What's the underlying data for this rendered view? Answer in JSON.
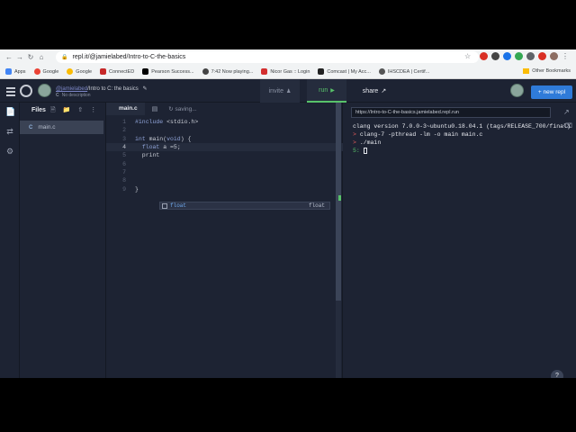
{
  "browser": {
    "url": "repl.it/@jamielabed/Intro-to-C-the-basics",
    "bookmarks": [
      {
        "label": "Apps",
        "color": "#4285f4"
      },
      {
        "label": "Google",
        "color": "#ea4335"
      },
      {
        "label": "Google",
        "color": "#fbbc05"
      },
      {
        "label": "ConnectED",
        "color": "#c62828"
      },
      {
        "label": "Pearson Success...",
        "color": "#000000"
      },
      {
        "label": "7:42 Now playing...",
        "color": "#444444"
      },
      {
        "label": "Nicor Gas :: Login",
        "color": "#d32f2f"
      },
      {
        "label": "Comcast | My Acc...",
        "color": "#222222"
      },
      {
        "label": "IHSCDEA | Certif...",
        "color": "#555555"
      }
    ],
    "other_bookmarks": "Other Bookmarks"
  },
  "header": {
    "user_link": "@jamielabed",
    "project_title": "/Intro to C: the basics",
    "description": "No description",
    "invite_label": "invite",
    "run_label": "run",
    "share_label": "share",
    "new_repl_label": "+ new repl"
  },
  "files": {
    "title": "Files",
    "items": [
      {
        "name": "main.c",
        "icon": "C"
      }
    ]
  },
  "editor": {
    "tab_label": "main.c",
    "status": "saving...",
    "lines": [
      {
        "num": "1",
        "text": "#include <stdio.h>"
      },
      {
        "num": "2",
        "text": ""
      },
      {
        "num": "3",
        "text": "int main(void) {"
      },
      {
        "num": "4",
        "text": "  float a =5;"
      },
      {
        "num": "5",
        "text": "  print"
      },
      {
        "num": "6",
        "text": ""
      },
      {
        "num": "7",
        "text": ""
      },
      {
        "num": "8",
        "text": ""
      },
      {
        "num": "9",
        "text": "}"
      }
    ],
    "current_line": 4,
    "autocomplete": {
      "suggestion": "float",
      "type": "float"
    }
  },
  "console": {
    "url": "https://Intro-to-C-the-basics.jamielabed.repl.run",
    "lines": [
      {
        "prefix": "",
        "text": "clang version 7.0.0-3~ubuntu0.18.04.1 (tags/RELEASE_700/final)"
      },
      {
        "prefix": "> ",
        "text": "clang-7 -pthread -lm -o main main.c"
      },
      {
        "prefix": "> ",
        "text": "./main"
      }
    ],
    "prompt": "5: "
  },
  "colors": {
    "accent_run": "#58c26a",
    "accent_new_repl": "#2f7bd9",
    "background": "#1d2333"
  }
}
